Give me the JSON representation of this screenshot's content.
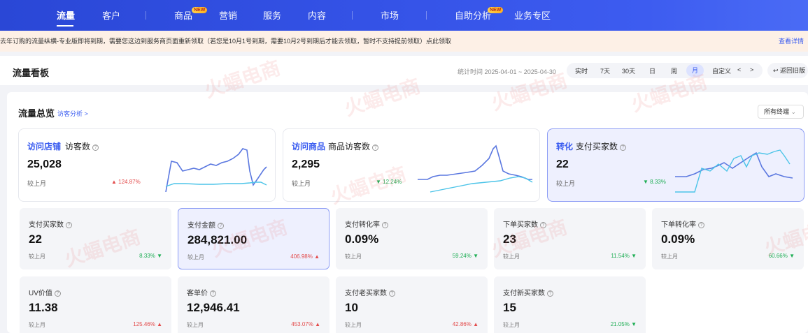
{
  "nav": {
    "items": [
      "流量",
      "客户",
      "商品",
      "营销",
      "服务",
      "内容",
      "市场",
      "自助分析",
      "业务专区"
    ],
    "new_tag": "NEW"
  },
  "notice": {
    "text": "去年订购的流量纵横-专业版即将到期，需要您这边到服务商页面重新领取（若您是10月1号到期，需要10月2号到期后才能去领取，暂时不支持提前领取）点此领取",
    "link": "查看详情"
  },
  "board": {
    "title": "流量看板",
    "stat_time": "统计时间 2025-04-01 ~ 2025-04-30",
    "ranges": [
      "实时",
      "7天",
      "30天",
      "日",
      "周",
      "月",
      "自定义"
    ],
    "selected_range": "月",
    "prev": "<",
    "next": ">",
    "back": "返回旧版"
  },
  "overview": {
    "title": "流量总览",
    "link": "访客分析 >",
    "terminal": "所有终端"
  },
  "big_cards": [
    {
      "tag": "访问店铺",
      "metric": "访客数",
      "value": "25,028",
      "compare_label": "较上月",
      "change": "124.87%",
      "dir": "up"
    },
    {
      "tag": "访问商品",
      "metric": "商品访客数",
      "value": "2,295",
      "compare_label": "较上月",
      "change": "12.24%",
      "dir": "down"
    },
    {
      "tag": "转化",
      "metric": "支付买家数",
      "value": "22",
      "compare_label": "较上月",
      "change": "8.33%",
      "dir": "down"
    }
  ],
  "metrics": [
    {
      "label": "支付买家数",
      "value": "22",
      "compare_label": "较上月",
      "change": "8.33%",
      "dir": "down"
    },
    {
      "label": "支付金额",
      "value": "284,821.00",
      "compare_label": "较上月",
      "change": "406.98%",
      "dir": "up"
    },
    {
      "label": "支付转化率",
      "value": "0.09%",
      "compare_label": "较上月",
      "change": "59.24%",
      "dir": "down"
    },
    {
      "label": "下单买家数",
      "value": "23",
      "compare_label": "较上月",
      "change": "11.54%",
      "dir": "down"
    },
    {
      "label": "下单转化率",
      "value": "0.09%",
      "compare_label": "较上月",
      "change": "60.66%",
      "dir": "down"
    },
    {
      "label": "UV价值",
      "value": "11.38",
      "compare_label": "较上月",
      "change": "125.46%",
      "dir": "up"
    },
    {
      "label": "客单价",
      "value": "12,946.41",
      "compare_label": "较上月",
      "change": "453.07%",
      "dir": "up"
    },
    {
      "label": "支付老买家数",
      "value": "10",
      "compare_label": "较上月",
      "change": "42.86%",
      "dir": "up"
    },
    {
      "label": "支付新买家数",
      "value": "15",
      "compare_label": "较上月",
      "change": "21.05%",
      "dir": "down"
    }
  ],
  "watermark": "火蝠电商",
  "colors": {
    "accent": "#3a5cf0",
    "up": "#e34c4c",
    "down": "#1fae55",
    "line_current": "#5b78e0",
    "line_prev": "#4cc4e8"
  }
}
